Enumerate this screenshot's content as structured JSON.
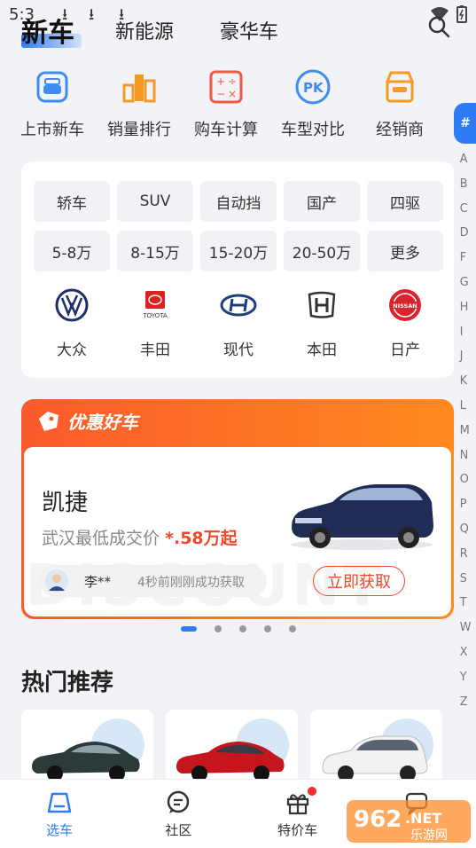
{
  "status": {
    "time": "5:3",
    "download_icon": "download-icon"
  },
  "top_tabs": [
    {
      "label": "新车",
      "active": true
    },
    {
      "label": "新能源",
      "active": false
    },
    {
      "label": "豪华车",
      "active": false
    }
  ],
  "quick_links": [
    {
      "label": "上市新车",
      "icon": "new-car-icon"
    },
    {
      "label": "销量排行",
      "icon": "ranking-icon"
    },
    {
      "label": "购车计算",
      "icon": "calculator-icon"
    },
    {
      "label": "车型对比",
      "icon": "compare-icon"
    },
    {
      "label": "经销商",
      "icon": "dealer-icon"
    }
  ],
  "filters": {
    "types": [
      "轿车",
      "SUV",
      "自动挡",
      "国产",
      "四驱"
    ],
    "prices": [
      "5-8万",
      "8-15万",
      "15-20万",
      "20-50万",
      "更多"
    ]
  },
  "brands": [
    {
      "name": "大众"
    },
    {
      "name": "丰田",
      "logo_text": "TOYOTA"
    },
    {
      "name": "现代"
    },
    {
      "name": "本田"
    },
    {
      "name": "日产",
      "logo_text": "NISSAN"
    }
  ],
  "alphabet": {
    "active": "#",
    "letters": [
      "A",
      "B",
      "C",
      "D",
      "F",
      "G",
      "H",
      "I",
      "J",
      "K",
      "L",
      "M",
      "N",
      "O",
      "P",
      "Q",
      "R",
      "S",
      "T",
      "W",
      "X",
      "Y",
      "Z"
    ]
  },
  "promo": {
    "header": "优惠好车",
    "car_name": "凯捷",
    "price_prefix": "武汉最低成交价",
    "price_value": "*.58万起",
    "ticker_user": "李**",
    "ticker_message": "4秒前刚刚成功获取",
    "button": "立即获取",
    "watermark": "DISCOUNT"
  },
  "pager": {
    "count": 5,
    "active": 0
  },
  "hot": {
    "title": "热门推荐"
  },
  "bottom_tabs": [
    {
      "label": "选车",
      "icon": "car-select-icon",
      "active": true
    },
    {
      "label": "社区",
      "icon": "community-icon",
      "active": false
    },
    {
      "label": "特价车",
      "icon": "gift-icon",
      "active": false
    },
    {
      "label": "",
      "icon": "message-icon",
      "active": false
    }
  ],
  "watermark_logo": {
    "text": "962",
    "suffix": ".NET",
    "sub": "乐游网"
  },
  "colors": {
    "accent": "#2d7cf6",
    "promo": "#f0472a",
    "quick_icon_blue": "#3e8cf0",
    "quick_icon_orange": "#f59a23",
    "quick_icon_red": "#ef5a45"
  }
}
